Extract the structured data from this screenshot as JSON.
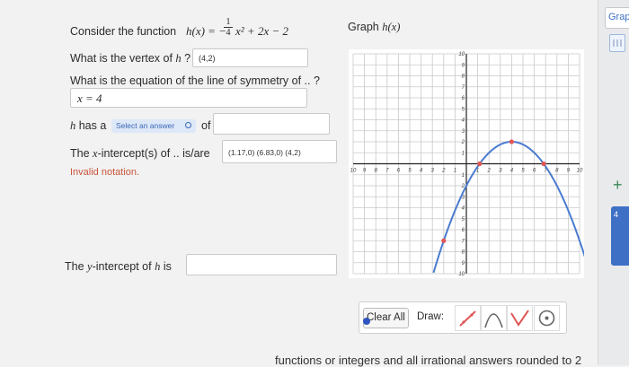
{
  "question": {
    "consider_prefix": "Consider the function",
    "function_math": "h(x) = −",
    "frac_num": "1",
    "frac_den": "4",
    "function_rest": "x² + 2x − 2",
    "vertex_prompt": "What is the vertex of",
    "vertex_var": "h",
    "vertex_suffix": "?",
    "vertex_answer": "(4,2)",
    "symmetry_prompt": "What is the equation of the line of symmetry of .. ?",
    "symmetry_answer": "x = 4",
    "has_var": "h",
    "has_text": "has a",
    "select_label": "Select an answer",
    "of_text": "of",
    "xint_prefix": "The",
    "xint_var": "x",
    "xint_text": "-intercept(s) of .. is/are",
    "xint_answer": "(1.17,0) (6.83,0) (4,2)",
    "invalid": "Invalid notation.",
    "yint_prefix": "The",
    "yint_var": "y",
    "yint_text": "-intercept of",
    "yint_func": "h",
    "yint_is": "is"
  },
  "graph": {
    "title_prefix": "Graph",
    "title_math": "h(x)",
    "clear_all": "Clear All",
    "draw_label": "Draw:",
    "x_ticks": [
      "10",
      "9",
      "8",
      "7",
      "6",
      "5",
      "4",
      "3",
      "2",
      "1",
      "1",
      "2",
      "3",
      "4",
      "5",
      "6",
      "7",
      "8",
      "9",
      "10"
    ],
    "y_ticks": [
      "10",
      "9",
      "8",
      "7",
      "6",
      "5",
      "4",
      "3",
      "2",
      "1",
      "1",
      "2",
      "3",
      "4",
      "5",
      "6",
      "7",
      "8",
      "9",
      "10"
    ]
  },
  "side_panel": {
    "tab_label": "Grap",
    "number": "4"
  },
  "bottom_text": "functions or integers and all irrational answers rounded to 2",
  "colors": {
    "curve": "#4a7bd0",
    "point": "#e05757",
    "selected_tool": "#e05757",
    "dot": "#2f55c0",
    "invalid": "#c9553a",
    "select_bg": "#dde8f8",
    "select_text": "#3b67b6"
  },
  "chart_data": {
    "type": "line",
    "xlim": [
      -10,
      10
    ],
    "ylim": [
      -10,
      10
    ],
    "grid": true,
    "curve": {
      "a": -0.25,
      "b": 2,
      "c": -2
    },
    "points": [
      {
        "x": 4,
        "y": 2
      },
      {
        "x": 1.17,
        "y": 0
      },
      {
        "x": 6.83,
        "y": 0
      },
      {
        "x": -2,
        "y": -7
      }
    ]
  }
}
